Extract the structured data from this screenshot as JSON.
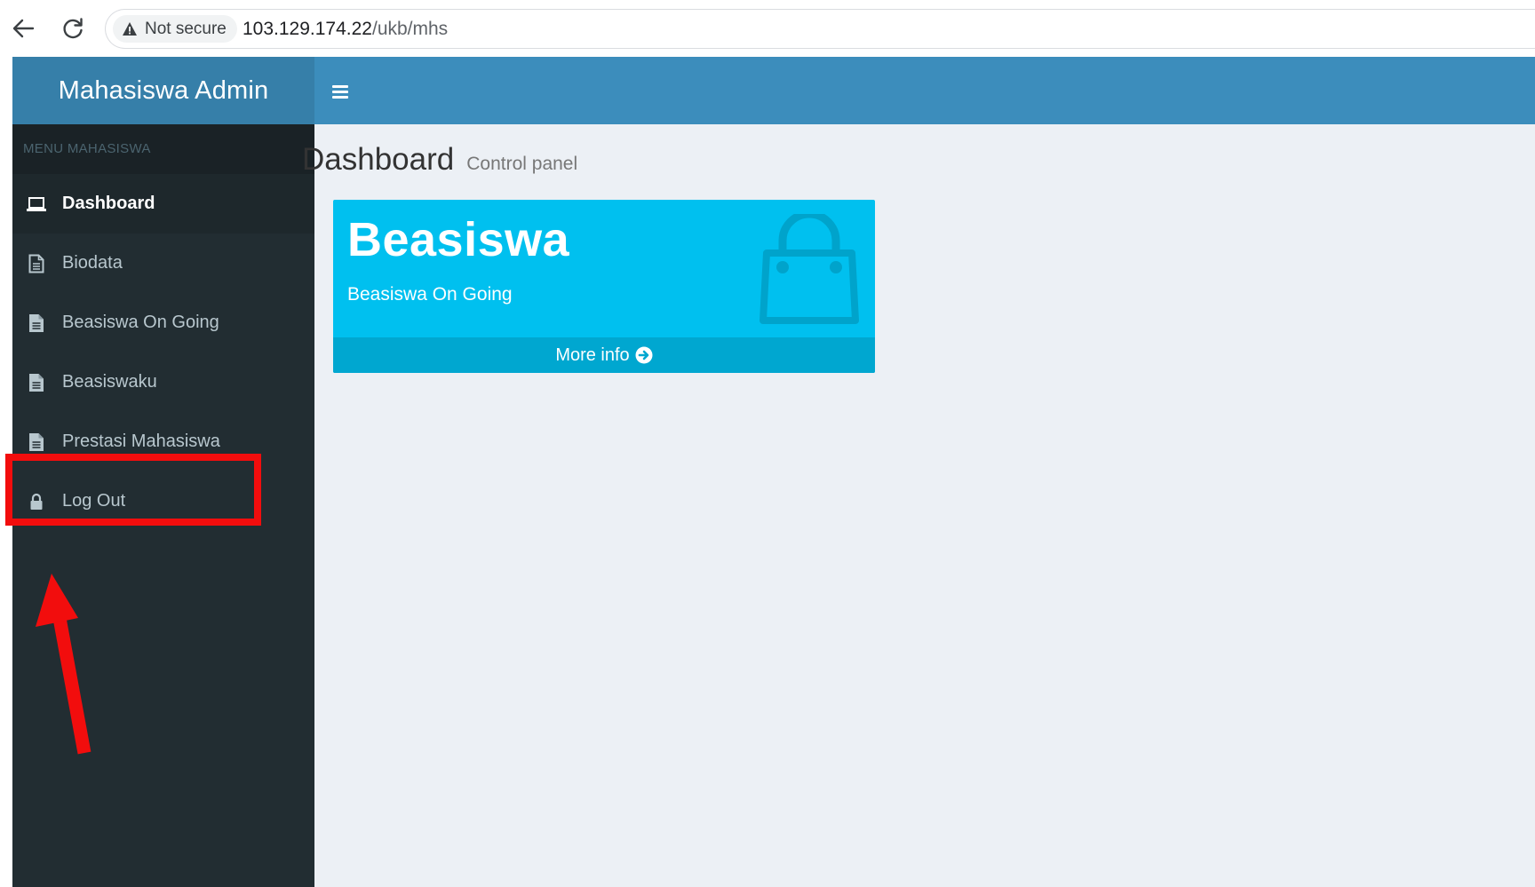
{
  "browser": {
    "security_label": "Not secure",
    "url_host": "103.129.174.22",
    "url_path": "/ukb/mhs"
  },
  "app": {
    "logo_text": "Mahasiswa Admin"
  },
  "sidebar": {
    "header": "MENU MAHASISWA",
    "items": [
      {
        "label": "Dashboard",
        "icon": "laptop-icon",
        "active": true
      },
      {
        "label": "Biodata",
        "icon": "file-outline-icon"
      },
      {
        "label": "Beasiswa On Going",
        "icon": "file-icon"
      },
      {
        "label": "Beasiswaku",
        "icon": "file-icon"
      },
      {
        "label": "Prestasi Mahasiswa",
        "icon": "file-icon"
      },
      {
        "label": "Log Out",
        "icon": "lock-icon"
      }
    ]
  },
  "content": {
    "title": "Dashboard",
    "subtitle": "Control panel",
    "card": {
      "title": "Beasiswa",
      "subtitle": "Beasiswa On Going",
      "footer_label": "More info",
      "icon": "shopping-bag-icon"
    }
  },
  "colors": {
    "header_blue": "#3c8dbc",
    "logo_blue": "#367fa9",
    "sidebar_dark": "#222d32",
    "card_aqua": "#00c0ef",
    "annotation_red": "#f20d0d"
  }
}
